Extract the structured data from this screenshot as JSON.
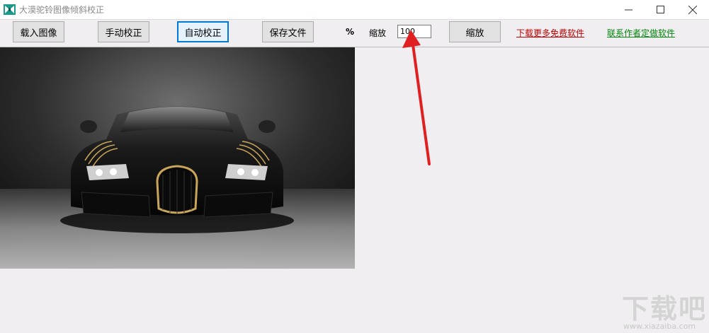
{
  "window": {
    "title": "大漠驼铃图像倾斜校正",
    "icon": "app-icon",
    "minimize_glyph": "—",
    "maximize_glyph": "☐",
    "close_glyph": "✕"
  },
  "toolbar": {
    "load_label": "载入图像",
    "manual_label": "手动校正",
    "auto_label": "自动校正",
    "save_label": "保存文件",
    "percent_label": "%",
    "zoom_label": "缩放",
    "zoom_value": "100",
    "zoom_button_label": "缩放",
    "download_link": "下载更多免费软件",
    "contact_link": "联系作者定做软件"
  },
  "colors": {
    "link_red": "#c00000",
    "link_green": "#00860b",
    "default_button_border": "#0078d7",
    "annotation_arrow": "#e02020"
  },
  "canvas": {
    "image": "black sports car front view"
  },
  "watermark": {
    "big_text": "下载吧",
    "small_text": "www.xiazaiba.com"
  }
}
